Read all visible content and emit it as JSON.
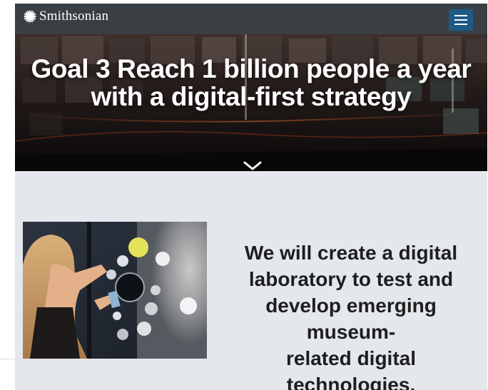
{
  "header": {
    "logo_text": "Smithsonian",
    "logo_icon": "sunburst-icon",
    "menu_icon": "hamburger-menu-icon"
  },
  "hero": {
    "title_line1": "Goal 3 Reach 1 billion people a year",
    "title_line2": "with a digital-first strategy",
    "scroll_icon": "chevron-down-icon"
  },
  "content": {
    "statement_line1": "We will create a digital",
    "statement_line2": "laboratory to test and",
    "statement_line3": "develop emerging museum-",
    "statement_line4": "related digital technologies.",
    "photo_alt": "Visitor interacting with digital touch screen display"
  },
  "colors": {
    "navbar": "#3a3f44",
    "menu_button": "#1e5a86",
    "section_bg": "#e4e8ec",
    "text_dark": "#1e1e1e"
  }
}
